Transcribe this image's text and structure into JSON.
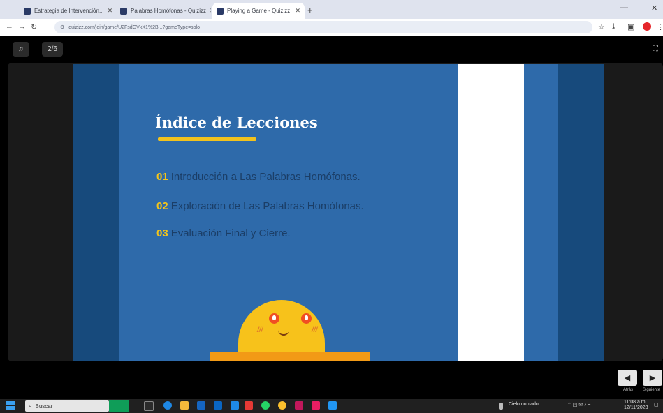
{
  "browser": {
    "tabs": [
      {
        "label": "Estrategia de Intervención..."
      },
      {
        "label": "Palabras Homófonas - Quizizz"
      },
      {
        "label": "Playing a Game - Quizizz"
      }
    ],
    "new_tab": "+",
    "url": "quizizz.com/join/game/U2FsdGVkX1%2B...?gameType=solo"
  },
  "app": {
    "music_label": "♫",
    "page_indicator": "2/6",
    "fullscreen_icon": "⛶"
  },
  "slide": {
    "title": "Índice de Lecciones",
    "lessons": [
      {
        "num": "01",
        "text": "Introducción a Las Palabras Homófonas."
      },
      {
        "num": "02",
        "text": "Exploración de Las Palabras Homófonas."
      },
      {
        "num": "03",
        "text": "Evaluación Final y Cierre."
      }
    ],
    "character_blush": "///"
  },
  "controls": {
    "prev_label": "Atrás",
    "next_label": "Siguiente"
  },
  "taskbar": {
    "search_placeholder": "Buscar",
    "weather": "Cielo nublado",
    "time": "11:08 a.m.",
    "date": "12/11/2023"
  },
  "colors": {
    "slide_blue": "#2e6aaa",
    "slide_dark": "#174a7c",
    "accent_yellow": "#f2c21d",
    "lesson_text": "#1b3e67"
  }
}
